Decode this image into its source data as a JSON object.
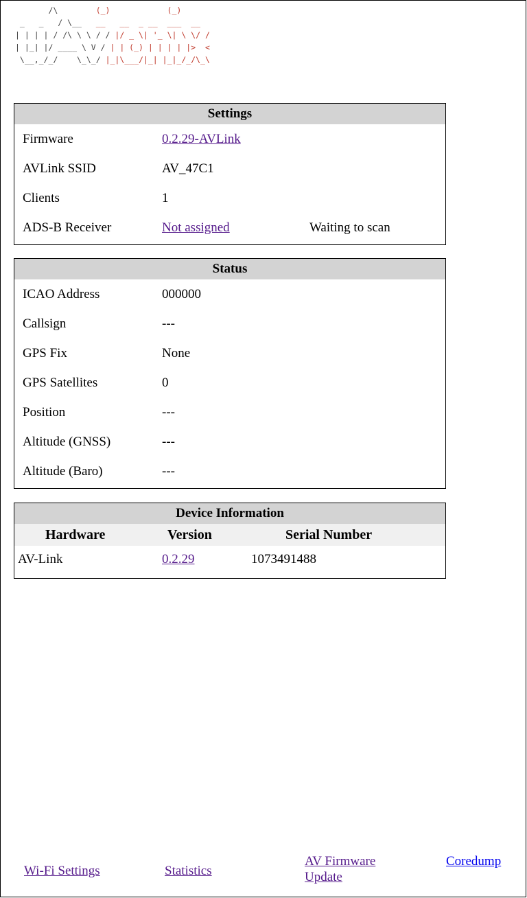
{
  "logo": {
    "lines": [
      {
        "a": "       /\\      ",
        "b": "  (_)            (_)"
      },
      {
        "a": " _   _   / \\__   ",
        "b": "__   __  _ __  ___  __"
      },
      {
        "a": "| | | | / /\\ \\ \\ / / ",
        "b": "|/ _ \\| '_ \\| \\ \\/ /"
      },
      {
        "a": "| |_| |/ ____ \\ V / ",
        "b": "| | (_) | | | | |>  <"
      },
      {
        "a": " \\__,_/_/    \\_\\_/ ",
        "b": "|_|\\___/|_| |_|_/_/\\_\\"
      }
    ]
  },
  "settings": {
    "title": "Settings",
    "firmware_label": "Firmware",
    "firmware_value": "0.2.29-AVLink",
    "ssid_label": "AVLink SSID",
    "ssid_value": "AV_47C1",
    "clients_label": "Clients",
    "clients_value": "1",
    "adsb_label": "ADS-B Receiver",
    "adsb_value": "Not assigned",
    "adsb_status": "Waiting to scan"
  },
  "status": {
    "title": "Status",
    "rows": [
      {
        "label": "ICAO Address",
        "value": "000000"
      },
      {
        "label": "Callsign",
        "value": "---"
      },
      {
        "label": "GPS Fix",
        "value": "None"
      },
      {
        "label": "GPS Satellites",
        "value": "0"
      },
      {
        "label": "Position",
        "value": "---"
      },
      {
        "label": "Altitude (GNSS)",
        "value": "---"
      },
      {
        "label": "Altitude (Baro)",
        "value": "---"
      }
    ]
  },
  "device": {
    "title": "Device Information",
    "col_hardware": "Hardware",
    "col_version": "Version",
    "col_serial": "Serial Number",
    "hardware": "AV-Link",
    "version": "0.2.29",
    "serial": "1073491488"
  },
  "footer": {
    "wifi": "Wi-Fi Settings",
    "statistics": "Statistics",
    "firmware_line1": "AV Firmware",
    "firmware_line2": "Update",
    "coredump": "Coredump"
  }
}
